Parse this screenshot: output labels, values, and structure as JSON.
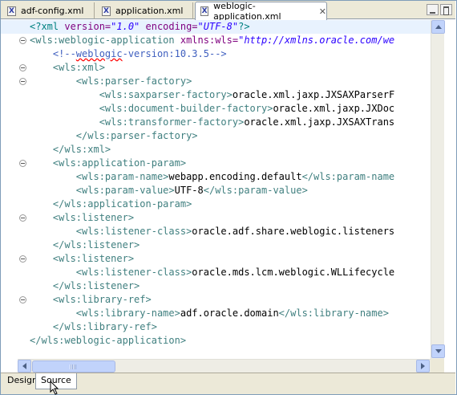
{
  "tabs": [
    {
      "label": "adf-config.xml",
      "active": false
    },
    {
      "label": "application.xml",
      "active": false
    },
    {
      "label": "weblogic-application.xml",
      "active": true
    }
  ],
  "tab_icon": "xml-file-icon",
  "tab_close_glyph": "✕",
  "window_controls": [
    "minimize-icon",
    "maximize-icon"
  ],
  "code_lines": [
    [
      [
        "pi",
        "<?xml "
      ],
      [
        "attr",
        "version="
      ],
      [
        "str",
        "\"1.0\""
      ],
      [
        "attr",
        " encoding="
      ],
      [
        "str",
        "\"UTF-8\""
      ],
      [
        "pi",
        "?>"
      ]
    ],
    [
      [
        "tag",
        "<wls:weblogic-application "
      ],
      [
        "attr",
        "xmlns:wls="
      ],
      [
        "str",
        "\"http://xmlns.oracle.com/we"
      ]
    ],
    [
      [
        "cmt",
        "    <!--"
      ],
      [
        "cmt_squig",
        "weblogic"
      ],
      [
        "cmt",
        "-version:10.3.5-->"
      ]
    ],
    [
      [
        "tag",
        "    <wls:xml>"
      ]
    ],
    [
      [
        "tag",
        "        <wls:parser-factory>"
      ]
    ],
    [
      [
        "tag",
        "            <wls:saxparser-factory>"
      ],
      [
        "txt",
        "oracle.xml.jaxp.JXSAXParserF"
      ]
    ],
    [
      [
        "tag",
        "            <wls:document-builder-factory>"
      ],
      [
        "txt",
        "oracle.xml.jaxp.JXDoc"
      ]
    ],
    [
      [
        "tag",
        "            <wls:transformer-factory>"
      ],
      [
        "txt",
        "oracle.xml.jaxp.JXSAXTrans"
      ]
    ],
    [
      [
        "tag",
        "        </wls:parser-factory>"
      ]
    ],
    [
      [
        "tag",
        "    </wls:xml>"
      ]
    ],
    [
      [
        "tag",
        "    <wls:application-param>"
      ]
    ],
    [
      [
        "tag",
        "        <wls:param-name>"
      ],
      [
        "txt",
        "webapp.encoding.default"
      ],
      [
        "tag",
        "</wls:param-name"
      ]
    ],
    [
      [
        "tag",
        "        <wls:param-value>"
      ],
      [
        "txt",
        "UTF-8"
      ],
      [
        "tag",
        "</wls:param-value>"
      ]
    ],
    [
      [
        "tag",
        "    </wls:application-param>"
      ]
    ],
    [
      [
        "tag",
        "    <wls:listener>"
      ]
    ],
    [
      [
        "tag",
        "        <wls:listener-class>"
      ],
      [
        "txt",
        "oracle.adf.share.weblogic.listeners"
      ]
    ],
    [
      [
        "tag",
        "    </wls:listener>"
      ]
    ],
    [
      [
        "tag",
        "    <wls:listener>"
      ]
    ],
    [
      [
        "tag",
        "        <wls:listener-class>"
      ],
      [
        "txt",
        "oracle.mds.lcm.weblogic.WLLifecycle"
      ]
    ],
    [
      [
        "tag",
        "    </wls:listener>"
      ]
    ],
    [
      [
        "tag",
        "    <wls:library-ref>"
      ]
    ],
    [
      [
        "tag",
        "        <wls:library-name>"
      ],
      [
        "txt",
        "adf.oracle.domain"
      ],
      [
        "tag",
        "</wls:library-name>"
      ]
    ],
    [
      [
        "tag",
        "    </wls:library-ref>"
      ]
    ],
    [
      [
        "tag",
        "</wls:weblogic-application>"
      ]
    ]
  ],
  "fold_lines": [
    1,
    3,
    4,
    10,
    14,
    17,
    20
  ],
  "highlighted_line": 0,
  "bottom_tabs": [
    {
      "label": "Design",
      "active": false
    },
    {
      "label": "Source",
      "active": true
    }
  ],
  "colors": {
    "tag": "#3f7f7f",
    "attribute": "#7f007f",
    "string": "#2a00ff",
    "comment": "#3f5fbf",
    "processing_instruction": "#008080",
    "current_line": "#e8f2fe"
  }
}
